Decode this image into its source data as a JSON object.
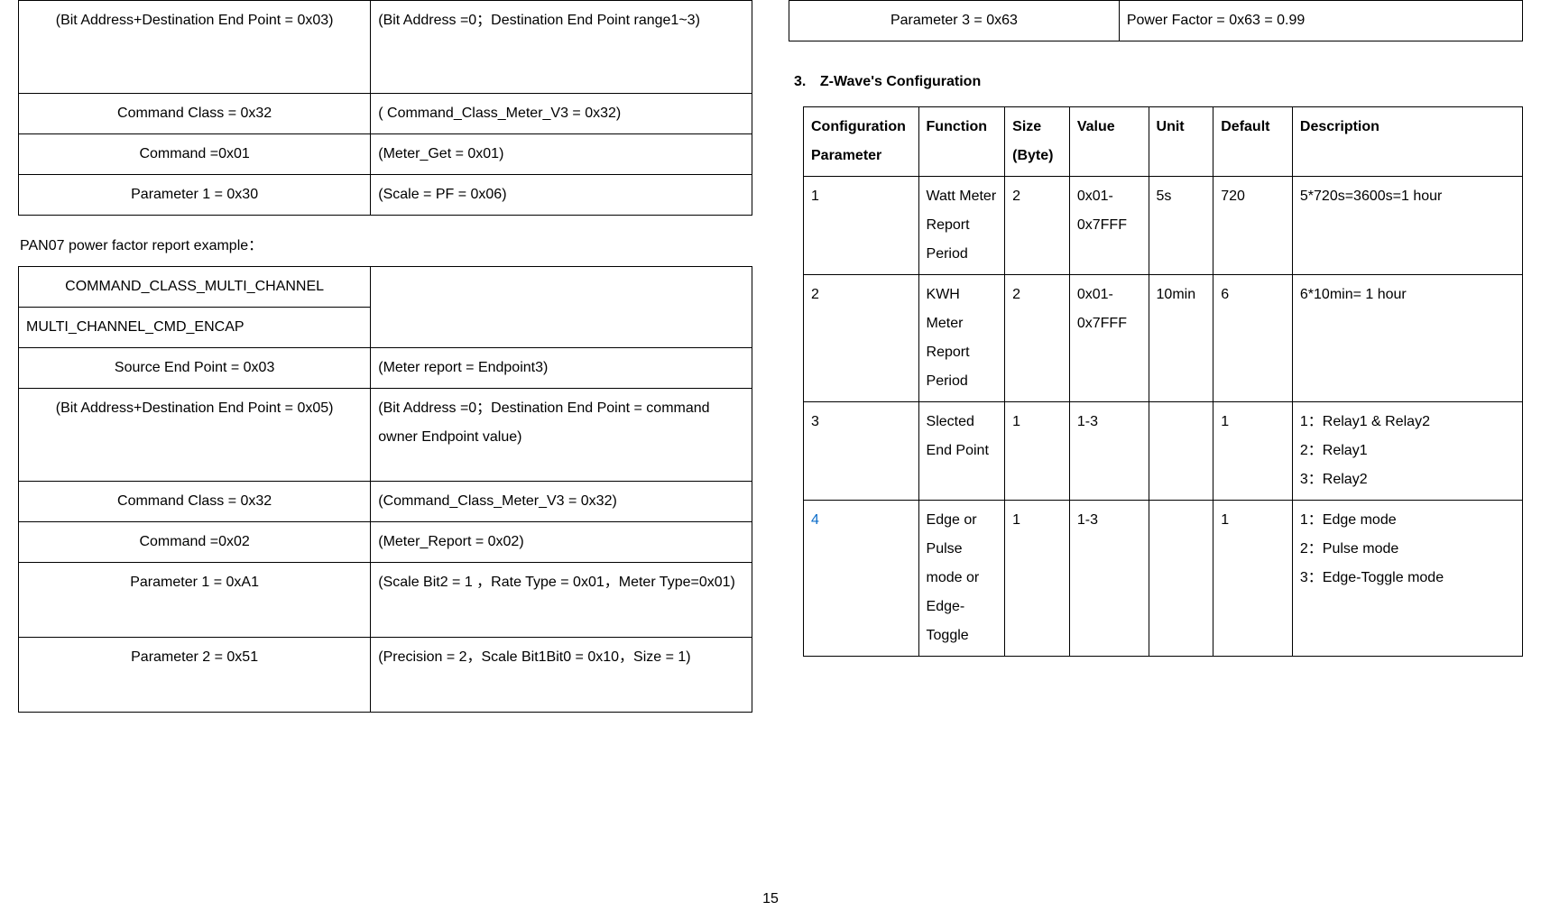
{
  "page_number": "15",
  "left": {
    "table1": {
      "r1c1": "(Bit Address+Destination End Point = 0x03)",
      "r1c2": "(Bit Address =0；Destination End Point range1~3)",
      "r2c1": "Command Class = 0x32",
      "r2c2": "( Command_Class_Meter_V3 = 0x32)",
      "r3c1": "Command =0x01",
      "r3c2": "(Meter_Get = 0x01)",
      "r4c1": "Parameter 1 = 0x30",
      "r4c2": "(Scale = PF = 0x06)"
    },
    "caption": "PAN07 power factor report example：",
    "table2": {
      "r1c1": "COMMAND_CLASS_MULTI_CHANNEL",
      "r1c2": "",
      "r2c1": "MULTI_CHANNEL_CMD_ENCAP",
      "r2c2": "",
      "r3c1": "Source End Point = 0x03",
      "r3c2": "(Meter report = Endpoint3)",
      "r4c1": "(Bit Address+Destination End Point = 0x05)",
      "r4c2": "(Bit Address =0；Destination End Point = command owner Endpoint value)",
      "r5c1": "Command Class = 0x32",
      "r5c2": "(Command_Class_Meter_V3 = 0x32)",
      "r6c1": "Command =0x02",
      "r6c2": "(Meter_Report = 0x02)",
      "r7c1": "Parameter 1 = 0xA1",
      "r7c2": "(Scale Bit2 = 1 ，Rate Type = 0x01，Meter Type=0x01)",
      "r8c1": "Parameter 2 = 0x51",
      "r8c2": "(Precision = 2，Scale Bit1Bit0 = 0x10，Size = 1)"
    }
  },
  "right": {
    "param3": {
      "c1": "Parameter 3 = 0x63",
      "c2": "Power Factor = 0x63 = 0.99"
    },
    "section_heading_num": "3.",
    "section_heading_text": "Z-Wave's Configuration",
    "cfg_headers": {
      "config_param": "Configuration Parameter",
      "function": "Function",
      "size": "Size (Byte)",
      "value": "Value",
      "unit": "Unit",
      "default": "Default",
      "description": "Description"
    },
    "cfg_rows": {
      "r1": {
        "cp": "1",
        "fn": "Watt Meter Report Period",
        "sz": "2",
        "vl": "0x01-0x7FFF",
        "un": "5s",
        "df": "720",
        "ds": "5*720s=3600s=1 hour"
      },
      "r2": {
        "cp": "2",
        "fn": "KWH Meter Report Period",
        "sz": "2",
        "vl": "0x01-0x7FFF",
        "un": "10min",
        "df": "6",
        "ds": "6*10min= 1 hour"
      },
      "r3": {
        "cp": "3",
        "fn": "Slected End Point",
        "sz": "1",
        "vl": "1-3",
        "un": "",
        "df": "1",
        "ds": "1：Relay1 & Relay2\n2：Relay1\n3：Relay2"
      },
      "r4": {
        "cp": "4",
        "fn": "Edge or Pulse mode or Edge-Toggle",
        "sz": "1",
        "vl": "1-3",
        "un": "",
        "df": "1",
        "ds": "1：Edge mode\n2：Pulse mode\n3：Edge-Toggle mode"
      }
    }
  }
}
